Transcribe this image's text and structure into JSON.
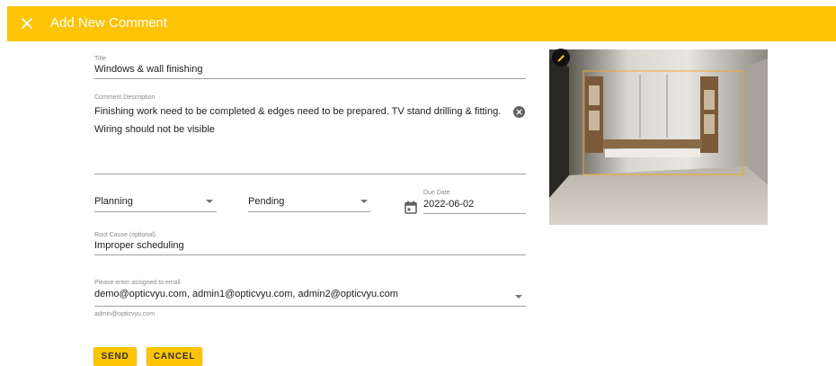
{
  "dialog": {
    "title": "Add New Comment",
    "icons": {
      "close": "close-icon",
      "edit": "pencil-icon",
      "clear": "clear-circle-icon",
      "calendar": "calendar-icon",
      "dropdown": "dropdown-arrow-icon"
    }
  },
  "form": {
    "title_label": "Title",
    "title_value": "Windows & wall finishing",
    "description_label": "Comment Description",
    "description_value": "Finishing work need to be completed & edges need to be prepared. TV stand drilling & fitting. Wiring should not be visible",
    "stage_value": "Planning",
    "status_value": "Pending",
    "due_date_label": "Due Date",
    "due_date_value": "2022-06-02",
    "root_cause_label": "Root Cause (optional)",
    "root_cause_value": "Improper scheduling",
    "assign_label": "Please enter assigned to email",
    "assign_value": "demo@opticvyu.com, admin1@opticvyu.com, admin2@opticvyu.com",
    "assign_hint": "admin@opticvyu.com"
  },
  "actions": {
    "send_label": "SEND",
    "cancel_label": "CANCEL"
  },
  "colors": {
    "accent": "#fdc305",
    "annotation_box": "#f5a623",
    "edit_button": "#111111"
  }
}
